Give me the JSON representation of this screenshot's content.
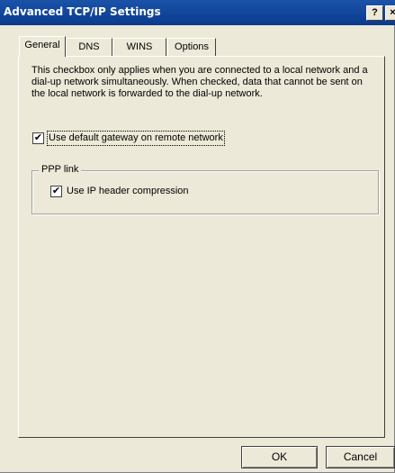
{
  "window": {
    "title": "Advanced TCP/IP Settings",
    "help_label": "?",
    "close_label": "×"
  },
  "tabs": [
    {
      "label": "General",
      "active": true
    },
    {
      "label": "DNS",
      "active": false
    },
    {
      "label": "WINS",
      "active": false
    },
    {
      "label": "Options",
      "active": false
    }
  ],
  "general": {
    "description": "This checkbox only applies when you are connected to a local network and a dial-up network simultaneously.  When checked, data that cannot be sent on the local network is forwarded to the dial-up network.",
    "default_gateway": {
      "label": "Use default gateway on remote network",
      "checked": true,
      "mark": "✔"
    },
    "ppp_group": {
      "legend": "PPP link",
      "ip_header_compression": {
        "label": "Use IP header compression",
        "checked": true,
        "mark": "✔"
      }
    }
  },
  "buttons": {
    "ok": "OK",
    "cancel": "Cancel"
  }
}
